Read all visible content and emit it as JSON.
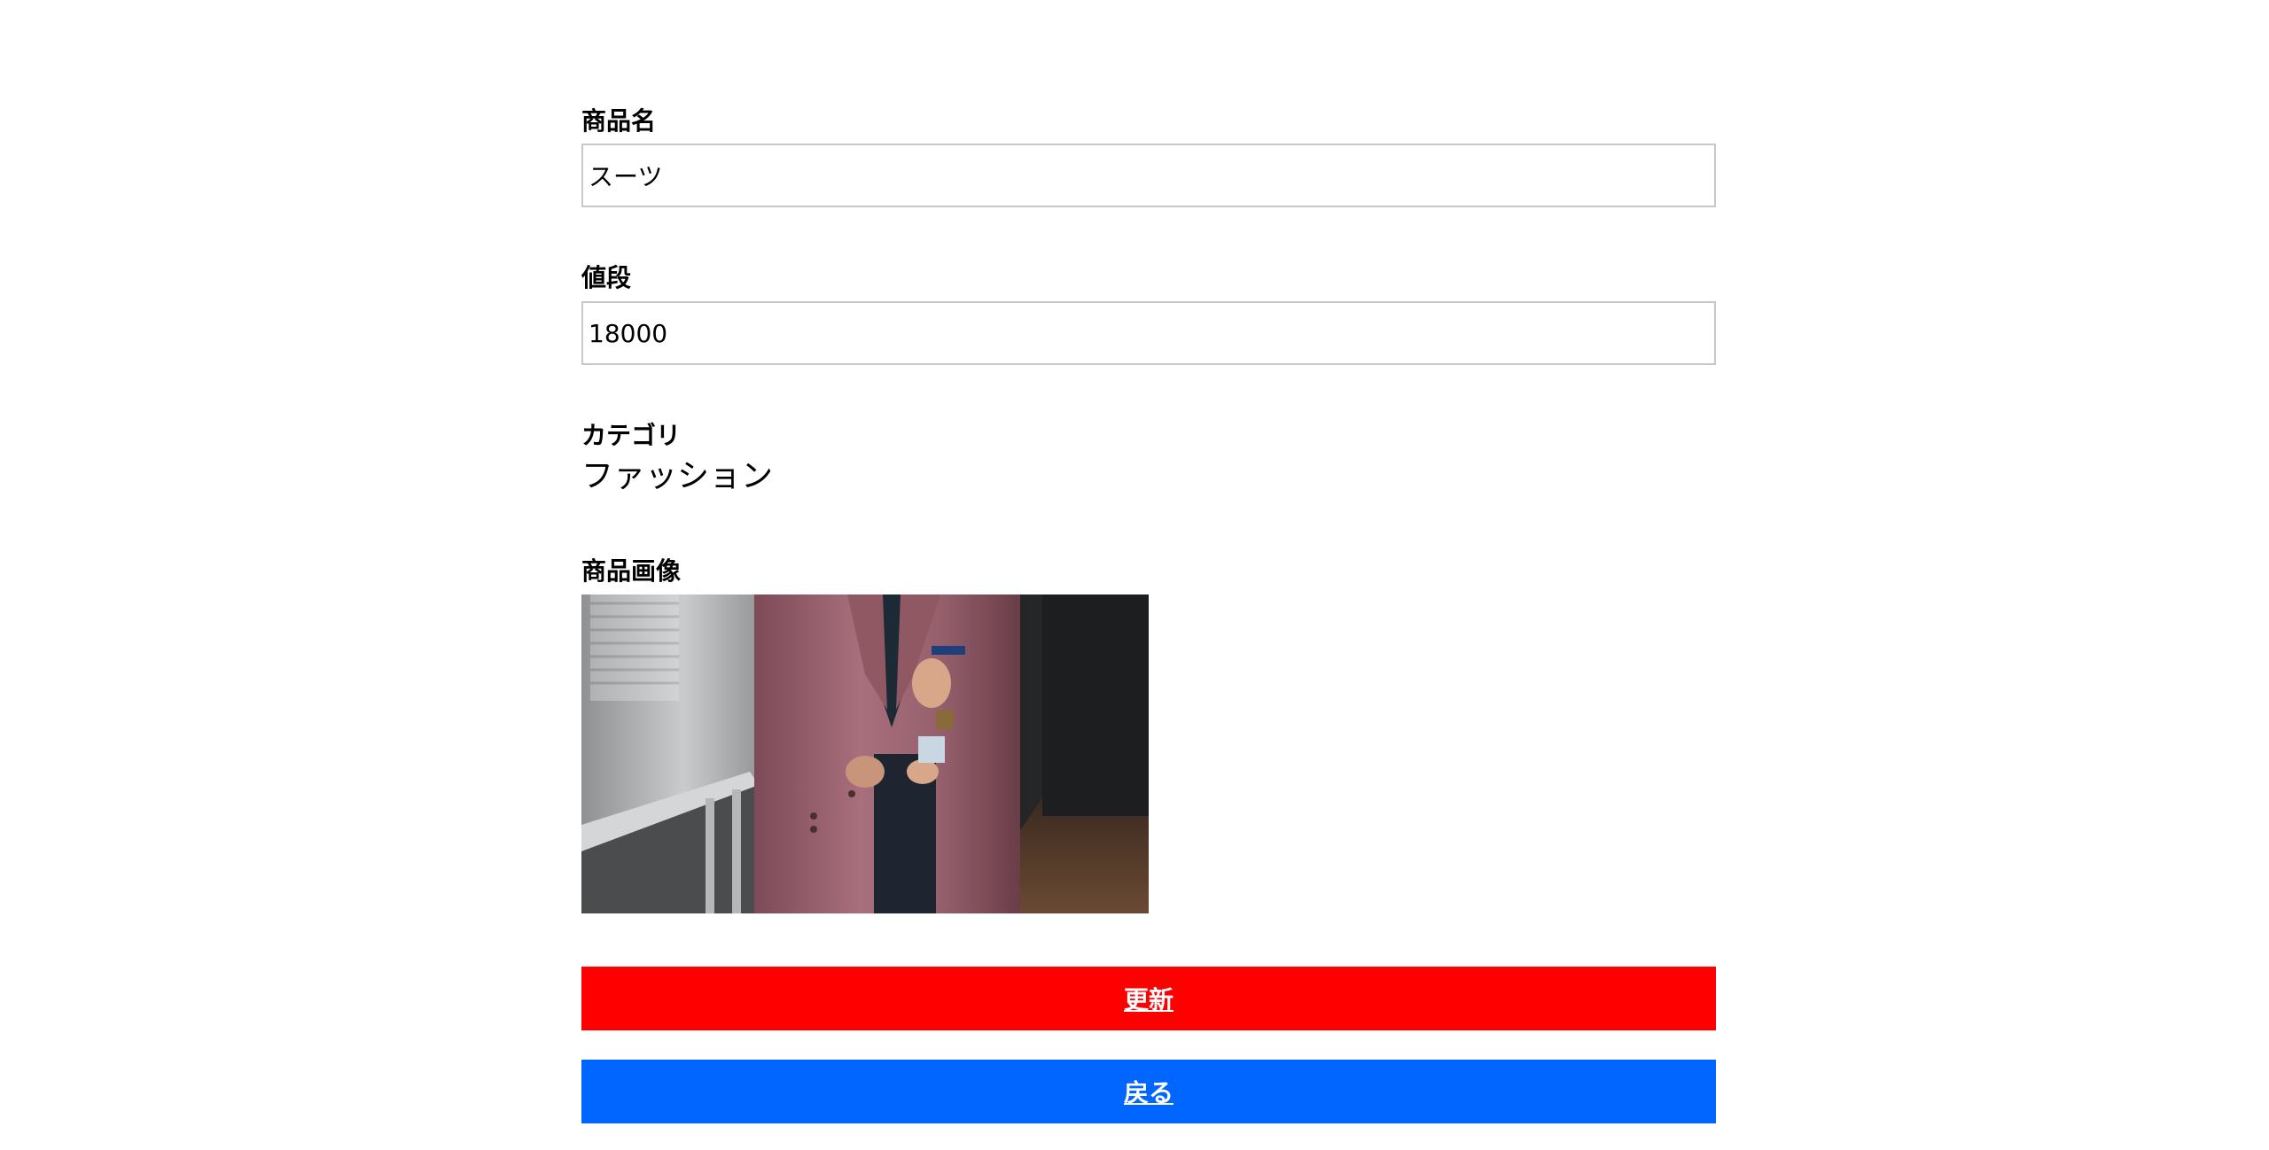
{
  "form": {
    "product_name": {
      "label": "商品名",
      "value": "スーツ"
    },
    "price": {
      "label": "値段",
      "value": "18000"
    },
    "category": {
      "label": "カテゴリ",
      "value": "ファッション"
    },
    "image": {
      "label": "商品画像"
    }
  },
  "buttons": {
    "update": {
      "label": "更新",
      "color": "#ff0000"
    },
    "back": {
      "label": "戻る",
      "color": "#0066ff"
    }
  }
}
